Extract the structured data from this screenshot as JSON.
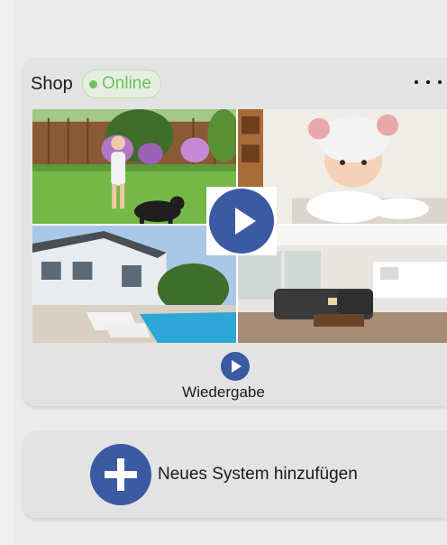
{
  "system": {
    "name": "Shop",
    "status": "Online",
    "status_color": "#6cc25a",
    "more_icon": "more-horizontal-icon"
  },
  "cameras": [
    {
      "scene": "garden-with-child-and-dog"
    },
    {
      "scene": "baby-with-knit-hat"
    },
    {
      "scene": "house-with-pool"
    },
    {
      "scene": "living-room"
    }
  ],
  "playback": {
    "label": "Wiedergabe",
    "icon": "play-icon"
  },
  "add_system": {
    "label": "Neues System hinzufügen",
    "icon": "plus-icon"
  },
  "colors": {
    "accent": "#3a5aa2",
    "background": "#ebebeb",
    "card": "#e3e3e3"
  }
}
